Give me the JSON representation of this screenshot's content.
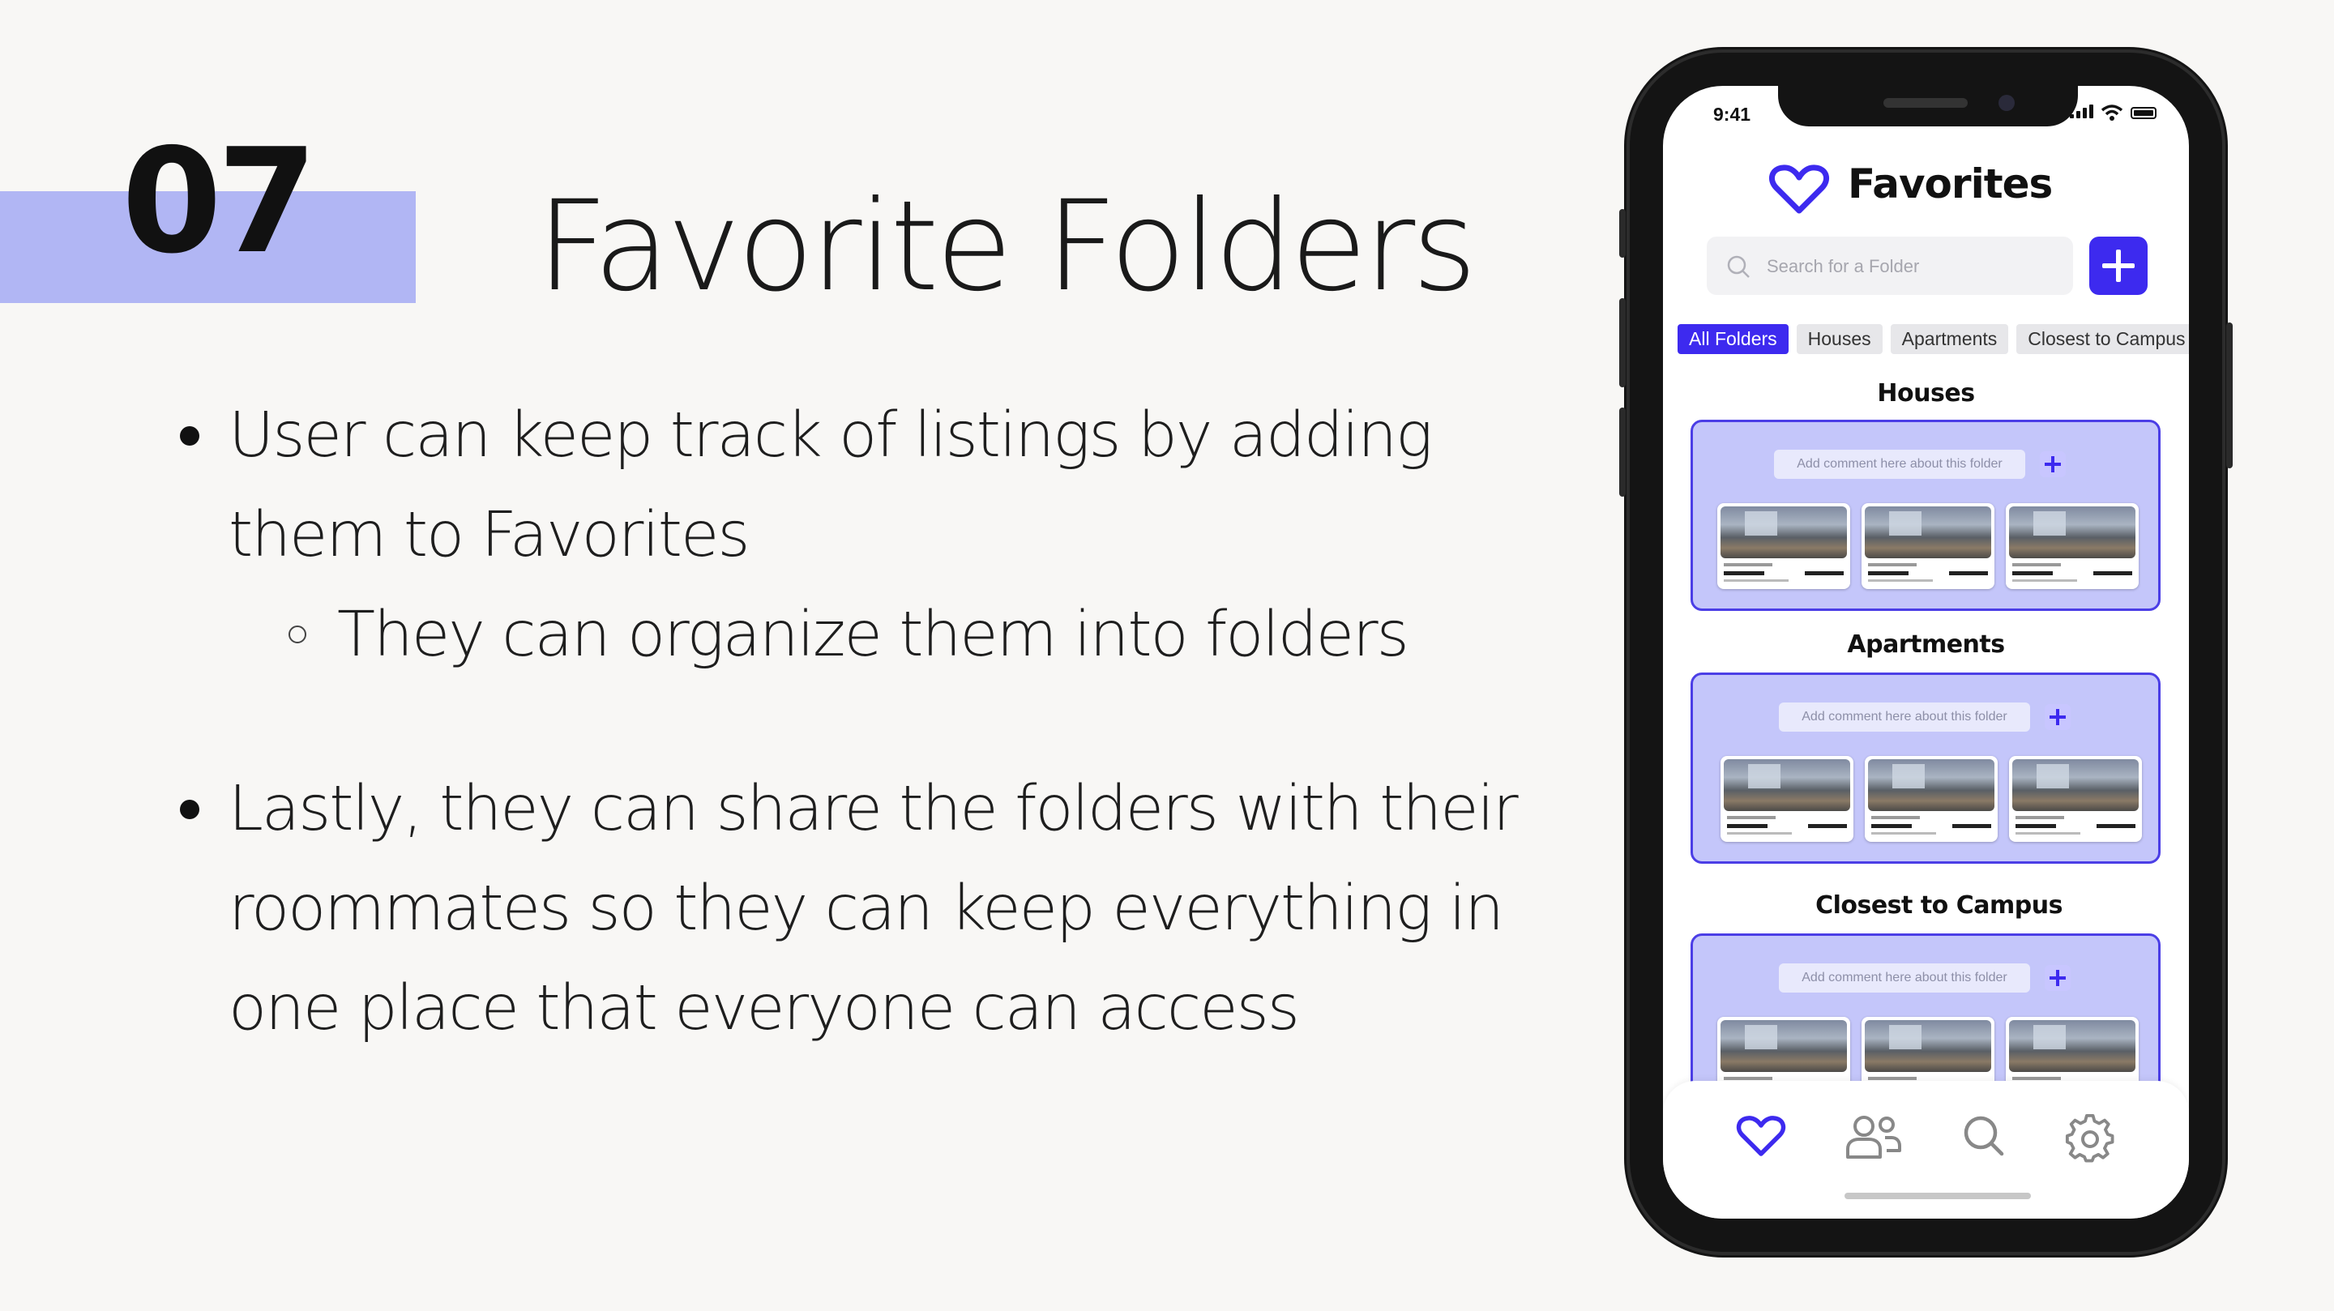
{
  "slide": {
    "number": "07",
    "title": "Favorite Folders",
    "accent_color": "#b1b6f4"
  },
  "bullets": [
    {
      "text": "User can keep track of listings by adding them to Favorites",
      "sub": [
        "They can organize them into folders"
      ]
    },
    {
      "text": "Lastly, they can share the folders with their roommates so they can keep everything in one place that everyone can access",
      "sub": []
    }
  ],
  "phone": {
    "status_time": "9:41",
    "screen_title": "Favorites",
    "search_placeholder": "Search for a Folder",
    "brand_color": "#3d2aef",
    "tabs": [
      "All Folders",
      "Houses",
      "Apartments",
      "Closest to Campus"
    ],
    "active_tab": "All Folders",
    "folders": [
      {
        "name": "Houses",
        "comment_placeholder": "Add comment here about this folder"
      },
      {
        "name": "Apartments",
        "comment_placeholder": "Add comment here about this folder"
      },
      {
        "name": "Closest to Campus",
        "comment_placeholder": "Add comment here about this folder"
      }
    ],
    "nav_icons": [
      "heart-icon",
      "roommates-icon",
      "search-icon",
      "settings-icon"
    ]
  }
}
